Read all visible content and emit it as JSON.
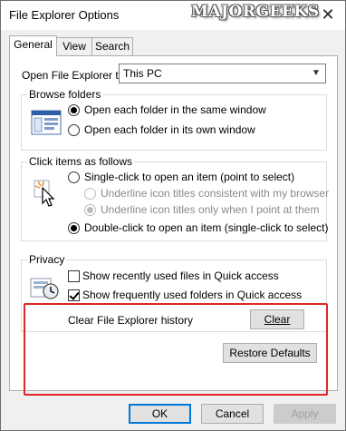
{
  "window": {
    "title": "File Explorer Options",
    "watermark": "MAJORGEEKS",
    "close_glyph": "✕"
  },
  "tabs": [
    {
      "label": "General",
      "active": true
    },
    {
      "label": "View",
      "active": false
    },
    {
      "label": "Search",
      "active": false
    }
  ],
  "open_explorer": {
    "label": "Open File Explorer to:",
    "value": "This PC"
  },
  "browse_folders": {
    "title": "Browse folders",
    "icon": "folder-window-icon",
    "options": [
      {
        "label": "Open each folder in the same window",
        "checked": true
      },
      {
        "label": "Open each folder in its own window",
        "checked": false
      }
    ]
  },
  "click_items": {
    "title": "Click items as follows",
    "icon": "cursor-click-icon",
    "single_click": {
      "label": "Single-click to open an item (point to select)",
      "checked": false
    },
    "sub_options": [
      {
        "label": "Underline icon titles consistent with my browser",
        "checked": false
      },
      {
        "label": "Underline icon titles only when I point at them",
        "checked": true
      }
    ],
    "double_click": {
      "label": "Double-click to open an item (single-click to select)",
      "checked": true
    }
  },
  "privacy": {
    "title": "Privacy",
    "icon": "privacy-clock-icon",
    "options": [
      {
        "label": "Show recently used files in Quick access",
        "checked": false
      },
      {
        "label": "Show frequently used folders in Quick access",
        "checked": true
      }
    ],
    "clear_label": "Clear File Explorer history",
    "clear_button": "Clear",
    "highlight_color": "#e02626"
  },
  "buttons": {
    "restore_defaults": "Restore Defaults",
    "ok": "OK",
    "cancel": "Cancel",
    "apply": "Apply"
  }
}
